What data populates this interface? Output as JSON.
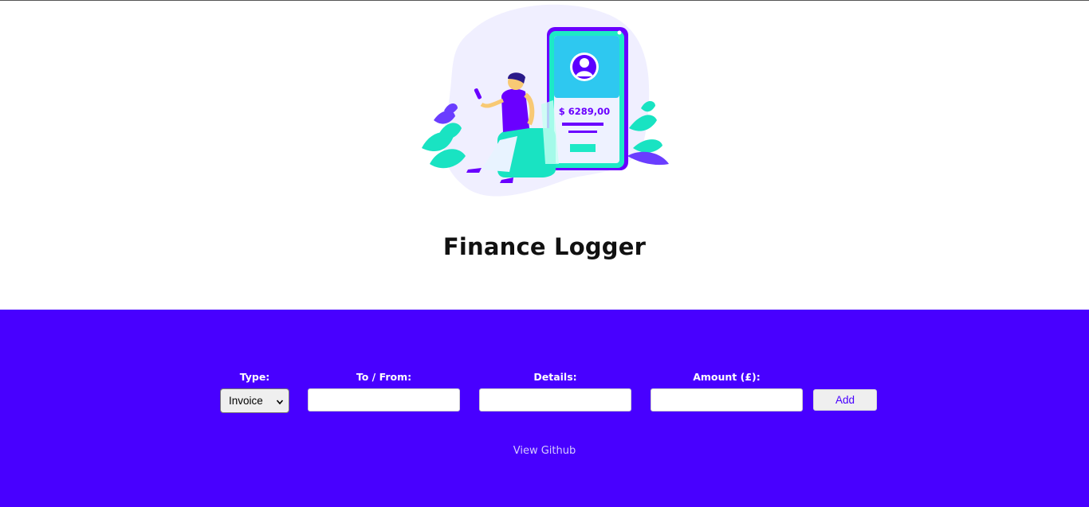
{
  "header": {
    "title": "Finance Logger",
    "illustration": {
      "phone_amount": "$ 6289,00"
    }
  },
  "form": {
    "type": {
      "label": "Type:",
      "selected": "Invoice"
    },
    "tofrom": {
      "label": "To / From:",
      "value": ""
    },
    "details": {
      "label": "Details:",
      "value": ""
    },
    "amount": {
      "label": "Amount (£):",
      "value": ""
    },
    "add_label": "Add"
  },
  "footer": {
    "github_label": "View Github"
  },
  "colors": {
    "primary": "#4800ff",
    "accent_teal": "#1de9c6",
    "background": "#ffffff"
  }
}
